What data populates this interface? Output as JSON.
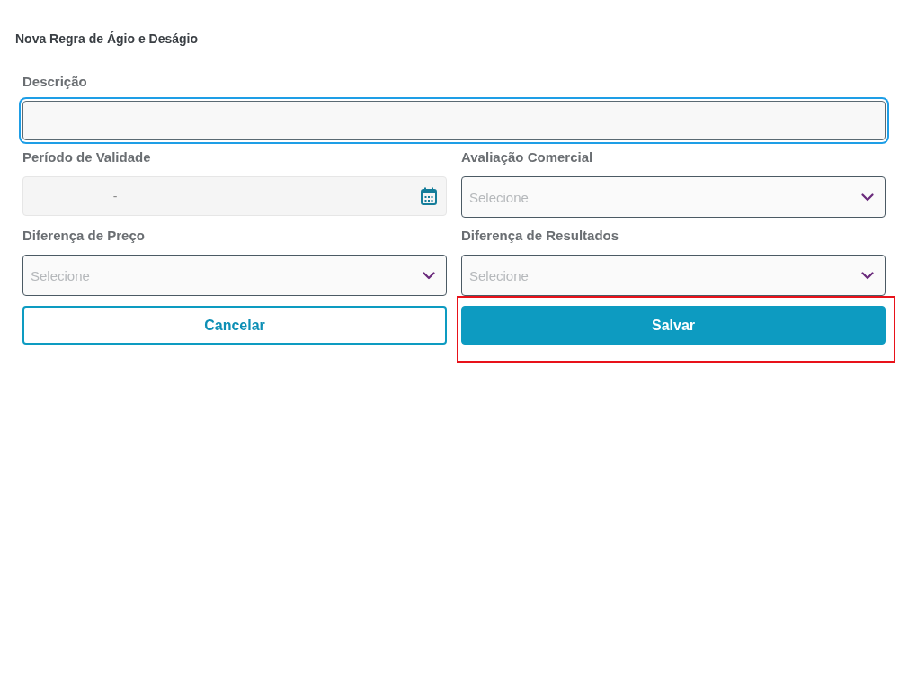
{
  "title": "Nova Regra de Ágio e Deságio",
  "fields": [
    {
      "kind": "text",
      "label": "Descrição",
      "focused": true
    },
    {
      "kind": "daterange",
      "label": "Período de Validade",
      "separator": "-",
      "focused": false
    },
    {
      "kind": "select",
      "label": "Avaliação Comercial",
      "placeholder": "Selecione",
      "focused": false
    },
    {
      "kind": "select",
      "label": "Diferença de Preço",
      "placeholder": "Selecione",
      "focused": false
    },
    {
      "kind": "select",
      "label": "Diferença de Resultados",
      "placeholder": "Selecione",
      "focused": false
    }
  ],
  "actions": [
    {
      "kind": "secondary",
      "label": "Cancelar"
    },
    {
      "kind": "primary",
      "label": "Salvar",
      "highlighted": true
    }
  ]
}
